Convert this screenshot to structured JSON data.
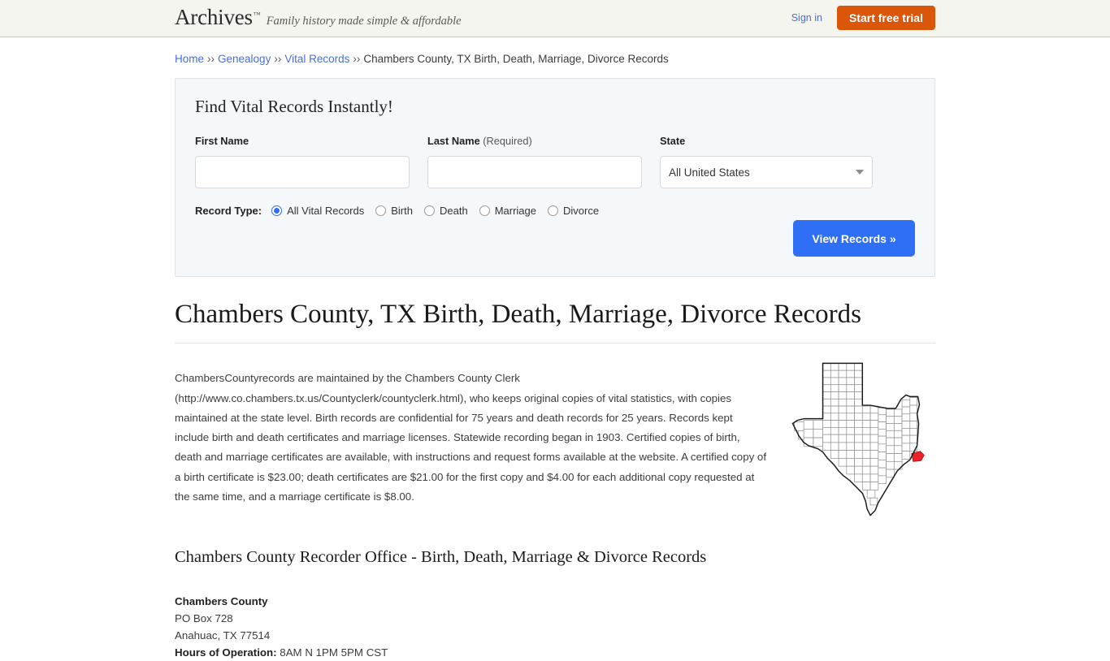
{
  "header": {
    "brand_name": "Archives",
    "brand_tm": "™",
    "tagline": "Family history made simple & affordable",
    "sign_in": "Sign in",
    "start_trial": "Start free trial",
    "accent_orange": "#d9560b",
    "link_blue": "#4a6fd4",
    "background": "#f5f5f0"
  },
  "breadcrumb": {
    "sep": "››",
    "items": [
      {
        "label": "Home",
        "link": true
      },
      {
        "label": "Genealogy",
        "link": true
      },
      {
        "label": "Vital Records",
        "link": true
      },
      {
        "label": "Chambers County, TX Birth, Death, Marriage, Divorce Records",
        "link": false
      }
    ]
  },
  "search_panel": {
    "title": "Find Vital Records Instantly!",
    "first_name": {
      "label": "First Name",
      "value": "",
      "placeholder": ""
    },
    "last_name": {
      "label": "Last Name",
      "required_note": "(Required)",
      "value": "",
      "placeholder": ""
    },
    "state": {
      "label": "State",
      "selected": "All United States"
    },
    "record_type": {
      "label": "Record Type:",
      "options": [
        {
          "label": "All Vital Records",
          "checked": true
        },
        {
          "label": "Birth",
          "checked": false
        },
        {
          "label": "Death",
          "checked": false
        },
        {
          "label": "Marriage",
          "checked": false
        },
        {
          "label": "Divorce",
          "checked": false
        }
      ]
    },
    "submit_label": "View Records »",
    "submit_color": "#2f6ff5",
    "panel_background": "#f5f8fa"
  },
  "page_title": "Chambers County, TX Birth, Death, Marriage, Divorce Records",
  "body_paragraph": "ChambersCountyrecords are maintained by the Chambers County Clerk (http://www.co.chambers.tx.us/Countyclerk/countyclerk.html), who keeps original copies of vital statistics, with copies maintained at the state level. Birth records are confidential for 75 years and death records for 25 years. Records kept include birth and death certificates and marriage licenses. Statewide recording began in 1903. Certified copies of birth, death and marriage certificates are available, with instructions and request forms available at the website. A certified copy of a birth certificate is $23.00; death certificates are $21.00 for the first copy and $4.00 for each additional copy requested at the same time, and a marriage certificate is $8.00.",
  "map": {
    "alt": "Map of Texas highlighting Chambers County",
    "highlight_color": "#e8232a",
    "outline_color": "#1a1a1a"
  },
  "section_heading": "Chambers County Recorder Office - Birth, Death, Marriage & Divorce Records",
  "address": {
    "name": "Chambers County",
    "line1": "PO Box 728",
    "line2": "Anahuac, TX 77514",
    "hours_label": "Hours of Operation:",
    "hours_value": "8AM N 1PM 5PM CST"
  }
}
